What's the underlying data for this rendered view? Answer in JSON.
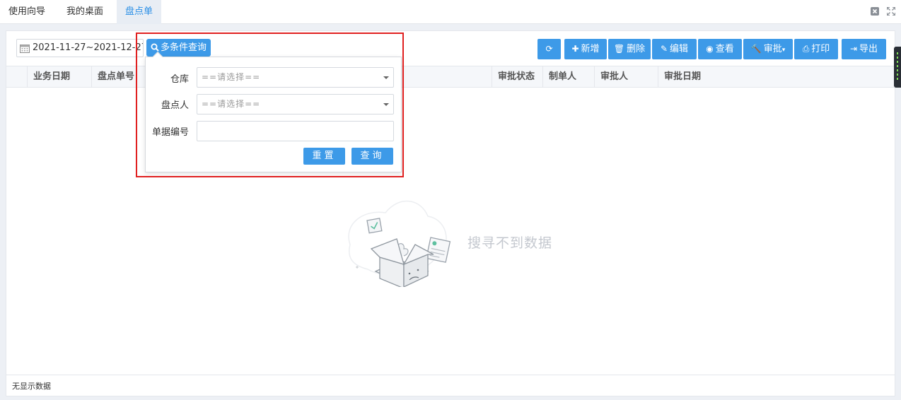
{
  "tabs": [
    {
      "label": "使用向导",
      "active": false
    },
    {
      "label": "我的桌面",
      "active": false
    },
    {
      "label": "盘点单",
      "active": true
    }
  ],
  "toolbar": {
    "date_range": "2021-11-27~2021-12-27",
    "condition_query": "多条件查询",
    "buttons": [
      {
        "label": "",
        "icon": "refresh-icon"
      },
      {
        "label": "新增",
        "icon": "plus-icon"
      },
      {
        "label": "删除",
        "icon": "trash-icon"
      },
      {
        "label": "编辑",
        "icon": "edit-icon"
      },
      {
        "label": "查看",
        "icon": "eye-icon"
      },
      {
        "label": "审批",
        "icon": "gavel-icon"
      },
      {
        "label": "打印",
        "icon": "print-icon"
      },
      {
        "label": "导出",
        "icon": "export-icon"
      }
    ]
  },
  "table": {
    "columns": [
      "业务日期",
      "盘点单号",
      "审批状态",
      "制单人",
      "审批人",
      "审批日期"
    ],
    "rows": []
  },
  "empty_state": {
    "text": "搜寻不到数据"
  },
  "footer": {
    "status": "无显示数据"
  },
  "query_popup": {
    "warehouse_label": "仓库",
    "warehouse_placeholder": "==请选择==",
    "counter_label": "盘点人",
    "counter_placeholder": "==请选择==",
    "doc_no_label": "单据编号",
    "doc_no_value": "",
    "reset_label": "重置",
    "query_label": "查询"
  },
  "colors": {
    "primary": "#3d9ae8",
    "active_tab": "#2a8fe6",
    "highlight": "#e02020"
  }
}
